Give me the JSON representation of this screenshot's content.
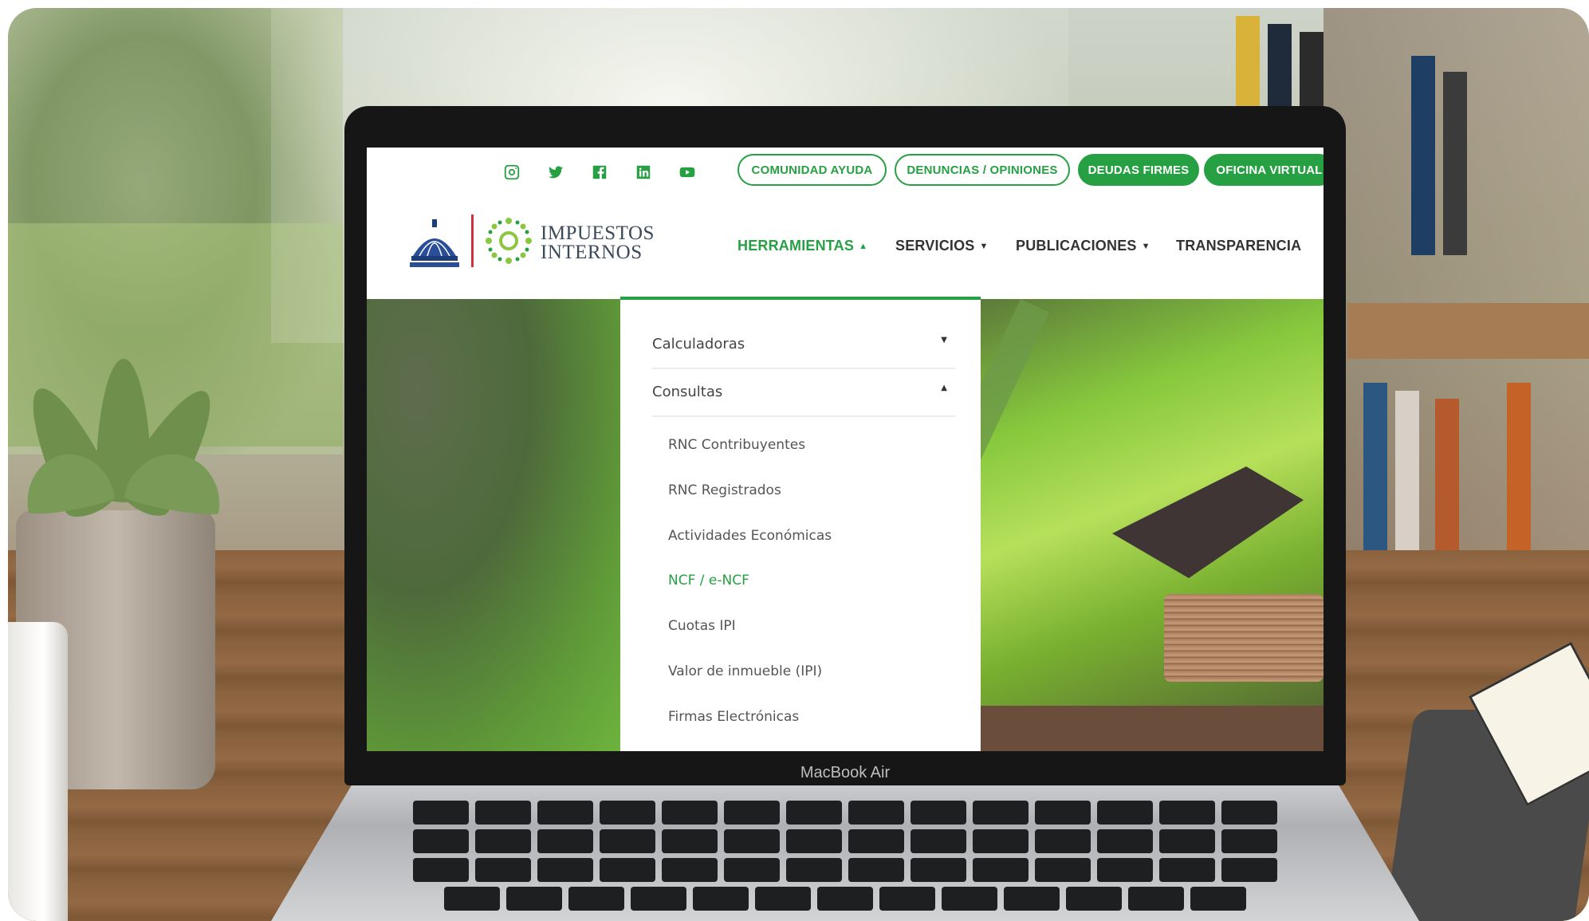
{
  "social": [
    {
      "name": "instagram-icon"
    },
    {
      "name": "twitter-icon"
    },
    {
      "name": "facebook-icon"
    },
    {
      "name": "linkedin-icon"
    },
    {
      "name": "youtube-icon"
    }
  ],
  "top_buttons": {
    "comunidad": "COMUNIDAD AYUDA",
    "denuncias": "DENUNCIAS / OPINIONES",
    "deudas": "DEUDAS FIRMES",
    "oficina": "OFICINA VIRTUAL"
  },
  "logo": {
    "line1": "IMPUESTOS",
    "line2": "INTERNOS"
  },
  "nav": {
    "herramientas": "HERRAMIENTAS",
    "servicios": "SERVICIOS",
    "publicaciones": "PUBLICACIONES",
    "transparencia": "TRANSPARENCIA",
    "caret_up": "▲",
    "caret_down": "▼"
  },
  "dropdown": {
    "calculadoras": "Calculadoras",
    "consultas": "Consultas",
    "items": [
      "RNC Contribuyentes",
      "RNC Registrados",
      "Actividades Económicas",
      "NCF / e-NCF",
      "Cuotas IPI",
      "Valor de inmueble (IPI)",
      "Firmas Electrónicas"
    ],
    "active_item": "NCF / e-NCF"
  },
  "device_label": "MacBook Air",
  "colors": {
    "brand_green": "#27a043",
    "logo_red": "#d0313a"
  }
}
